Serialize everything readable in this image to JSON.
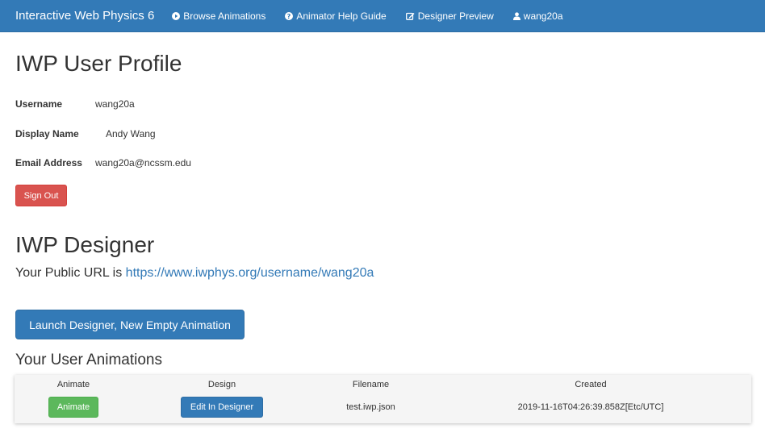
{
  "navbar": {
    "brand": "Interactive Web Physics 6",
    "items": [
      {
        "label": "Browse Animations",
        "icon": "play-circle-icon"
      },
      {
        "label": "Animator Help Guide",
        "icon": "question-circle-icon"
      },
      {
        "label": "Designer Preview",
        "icon": "edit-icon"
      },
      {
        "label": "wang20a",
        "icon": "user-icon"
      }
    ]
  },
  "profile": {
    "title": "IWP User Profile",
    "username_label": "Username",
    "username": "wang20a",
    "display_name_label": "Display Name",
    "display_name": "Andy Wang",
    "email_label": "Email Address",
    "email": "wang20a@ncssm.edu",
    "sign_out": "Sign Out"
  },
  "designer": {
    "title": "IWP Designer",
    "public_url_prefix": "Your Public URL is",
    "public_url": "https://www.iwphys.org/username/wang20a",
    "launch_button": "Launch Designer, New Empty Animation"
  },
  "animations": {
    "title": "Your User Animations",
    "columns": [
      "Animate",
      "Design",
      "Filename",
      "Created"
    ],
    "rows": [
      {
        "animate_button": "Animate",
        "design_button": "Edit In Designer",
        "filename": "test.iwp.json",
        "created": "2019-11-16T04:26:39.858Z[Etc/UTC]"
      }
    ]
  },
  "colors": {
    "navbar": "#337ab7",
    "danger": "#d9534f",
    "success": "#5cb85c",
    "primary": "#337ab7",
    "link": "#337ab7"
  }
}
